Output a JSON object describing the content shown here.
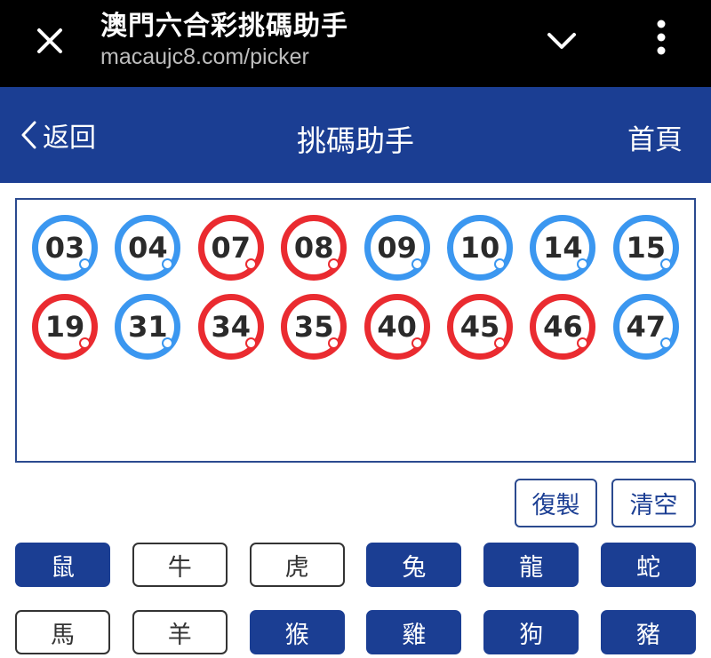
{
  "browser": {
    "title": "澳門六合彩挑碼助手",
    "url": "macaujc8.com/picker"
  },
  "header": {
    "back_label": "返回",
    "title": "挑碼助手",
    "home_label": "首頁"
  },
  "colors": {
    "header_bg": "#1b3e93",
    "ball_blue": "#3b97f0",
    "ball_red": "#ea2b30"
  },
  "picked": [
    {
      "num": "03",
      "color": "blue"
    },
    {
      "num": "04",
      "color": "blue"
    },
    {
      "num": "07",
      "color": "red"
    },
    {
      "num": "08",
      "color": "red"
    },
    {
      "num": "09",
      "color": "blue"
    },
    {
      "num": "10",
      "color": "blue"
    },
    {
      "num": "14",
      "color": "blue"
    },
    {
      "num": "15",
      "color": "blue"
    },
    {
      "num": "19",
      "color": "red"
    },
    {
      "num": "31",
      "color": "blue"
    },
    {
      "num": "34",
      "color": "red"
    },
    {
      "num": "35",
      "color": "red"
    },
    {
      "num": "40",
      "color": "red"
    },
    {
      "num": "45",
      "color": "red"
    },
    {
      "num": "46",
      "color": "red"
    },
    {
      "num": "47",
      "color": "blue"
    }
  ],
  "actions": {
    "copy_label": "復製",
    "clear_label": "清空"
  },
  "zodiacs": [
    {
      "label": "鼠",
      "selected": true
    },
    {
      "label": "牛",
      "selected": false
    },
    {
      "label": "虎",
      "selected": false
    },
    {
      "label": "兔",
      "selected": true
    },
    {
      "label": "龍",
      "selected": true
    },
    {
      "label": "蛇",
      "selected": true
    },
    {
      "label": "馬",
      "selected": false
    },
    {
      "label": "羊",
      "selected": false
    },
    {
      "label": "猴",
      "selected": true
    },
    {
      "label": "雞",
      "selected": true
    },
    {
      "label": "狗",
      "selected": true
    },
    {
      "label": "豬",
      "selected": true
    }
  ]
}
